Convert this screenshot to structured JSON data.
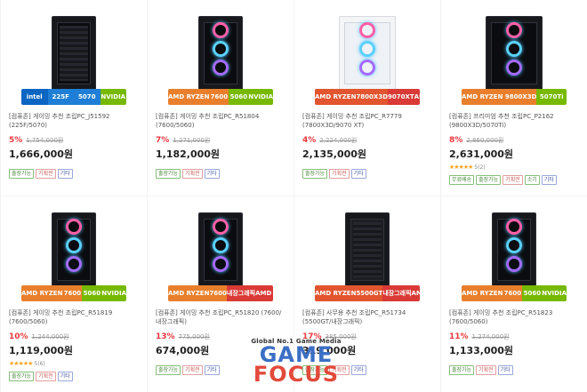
{
  "accent": {
    "discount": "#e8383d",
    "stars": "#f5a623"
  },
  "products": [
    {
      "pc_style": "mesh",
      "badge": [
        {
          "text": "intel",
          "color": "#0a66c2"
        },
        {
          "text": "225F",
          "color": "#1f7fd6"
        },
        {
          "text": "5070",
          "color": "#1f7fd6"
        },
        {
          "text": "NVIDIA",
          "color": "#77b900"
        }
      ],
      "name": "[컴퓨존] 게이밍 추천 조립PC_J51592 (225F/5070)",
      "discount": "5%",
      "original_price": "1,754,000원",
      "price": "1,666,000원",
      "rating": null,
      "tags": [
        {
          "label": "출장가능",
          "style": "green"
        },
        {
          "label": "기획전",
          "style": "red"
        },
        {
          "label": "기타",
          "style": "blue"
        }
      ]
    },
    {
      "pc_style": "fans",
      "badge": [
        {
          "text": "AMD RYZEN",
          "color": "#e97f2c"
        },
        {
          "text": "7600",
          "color": "#e97f2c"
        },
        {
          "text": "5060",
          "color": "#77b900"
        },
        {
          "text": "NVIDIA",
          "color": "#77b900"
        }
      ],
      "name": "[컴퓨존] 게이밍 추천 조립PC_R51804 (7600/5060)",
      "discount": "7%",
      "original_price": "1,271,000원",
      "price": "1,182,000원",
      "rating": null,
      "tags": [
        {
          "label": "출장가능",
          "style": "green"
        },
        {
          "label": "기획전",
          "style": "red"
        },
        {
          "label": "기타",
          "style": "blue"
        }
      ]
    },
    {
      "pc_style": "white",
      "badge": [
        {
          "text": "AMD RYZEN",
          "color": "#e2552f"
        },
        {
          "text": "7800X3D",
          "color": "#e2552f"
        },
        {
          "text": "9070XT",
          "color": "#d93a36"
        },
        {
          "text": "AMD RADEON",
          "color": "#d93a36"
        }
      ],
      "name": "[컴퓨존] 게이밍 추천 조립PC_R7779 (7800X3D/9070 XT)",
      "discount": "4%",
      "original_price": "2,224,000원",
      "price": "2,135,000원",
      "rating": null,
      "tags": [
        {
          "label": "출장가능",
          "style": "green"
        },
        {
          "label": "기획전",
          "style": "red"
        },
        {
          "label": "기타",
          "style": "blue"
        }
      ]
    },
    {
      "pc_style": "wide",
      "badge": [
        {
          "text": "AMD RYZEN 9800X3D",
          "color": "#e97f2c"
        },
        {
          "text": "5070Ti",
          "color": "#77b900"
        }
      ],
      "name": "[컴퓨존] 프리미엄 추천 조립PC_P2162 (9800X3D/5070Ti)",
      "discount": "8%",
      "original_price": "2,860,000원",
      "price": "2,631,000원",
      "rating": {
        "stars": "★★★★★",
        "count": "5(2)"
      },
      "tags": [
        {
          "label": "무료배송",
          "style": "green"
        },
        {
          "label": "출장가능",
          "style": "green"
        },
        {
          "label": "기획전",
          "style": "red"
        },
        {
          "label": "소기",
          "style": "green"
        },
        {
          "label": "기타",
          "style": "blue"
        }
      ]
    },
    {
      "pc_style": "fans",
      "badge": [
        {
          "text": "AMD RYZEN",
          "color": "#e97f2c"
        },
        {
          "text": "7600",
          "color": "#e97f2c"
        },
        {
          "text": "5060",
          "color": "#77b900"
        },
        {
          "text": "NVIDIA",
          "color": "#77b900"
        }
      ],
      "name": "[컴퓨존] 게이밍 추천 조립PC_R51819 (7600/5060)",
      "discount": "10%",
      "original_price": "1,244,000원",
      "price": "1,119,000원",
      "rating": {
        "stars": "★★★★★",
        "count": "5(6)"
      },
      "tags": [
        {
          "label": "출장가능",
          "style": "green"
        },
        {
          "label": "기획전",
          "style": "red"
        },
        {
          "label": "기타",
          "style": "blue"
        }
      ]
    },
    {
      "pc_style": "fans",
      "badge": [
        {
          "text": "AMD RYZEN",
          "color": "#e97f2c"
        },
        {
          "text": "7600",
          "color": "#e97f2c"
        },
        {
          "text": "내장그래픽",
          "color": "#d93a36"
        },
        {
          "text": "AMD RADEON",
          "color": "#d93a36"
        }
      ],
      "name": "[컴퓨존] 게이밍 추천 조립PC_R51820 (7600/내장그래픽)",
      "discount": "13%",
      "original_price": "775,000원",
      "price": "674,000원",
      "rating": null,
      "tags": [
        {
          "label": "출장가능",
          "style": "green"
        },
        {
          "label": "기획전",
          "style": "red"
        },
        {
          "label": "기타",
          "style": "blue"
        }
      ]
    },
    {
      "pc_style": "plain",
      "badge": [
        {
          "text": "AMD RYZEN",
          "color": "#e2552f"
        },
        {
          "text": "5500GT",
          "color": "#e2552f"
        },
        {
          "text": "내장그래픽",
          "color": "#d93a36"
        },
        {
          "text": "AMD RADEON",
          "color": "#d93a36"
        }
      ],
      "name": "[컴퓨존] 사무용 추천 조립PC_R51734 (5500GT/내장그래픽)",
      "discount": "17%",
      "original_price": "385,000원",
      "price": "319,000원",
      "rating": null,
      "tags": [
        {
          "label": "출장가능",
          "style": "green"
        },
        {
          "label": "기획전",
          "style": "red"
        },
        {
          "label": "기타",
          "style": "blue"
        }
      ]
    },
    {
      "pc_style": "fans",
      "badge": [
        {
          "text": "AMD RYZEN",
          "color": "#e97f2c"
        },
        {
          "text": "7600",
          "color": "#e97f2c"
        },
        {
          "text": "5060",
          "color": "#77b900"
        },
        {
          "text": "NVIDIA",
          "color": "#77b900"
        }
      ],
      "name": "[컴퓨존] 게이밍 추천 조립PC_R51823 (7600/5060)",
      "discount": "11%",
      "original_price": "1,274,000원",
      "price": "1,133,000원",
      "rating": null,
      "tags": [
        {
          "label": "출장가능",
          "style": "green"
        },
        {
          "label": "기획전",
          "style": "red"
        },
        {
          "label": "기타",
          "style": "blue"
        }
      ]
    }
  ],
  "watermark": {
    "tagline": "Global No.1 Game Media",
    "word1": "GAME",
    "word2": "FOCUS"
  }
}
